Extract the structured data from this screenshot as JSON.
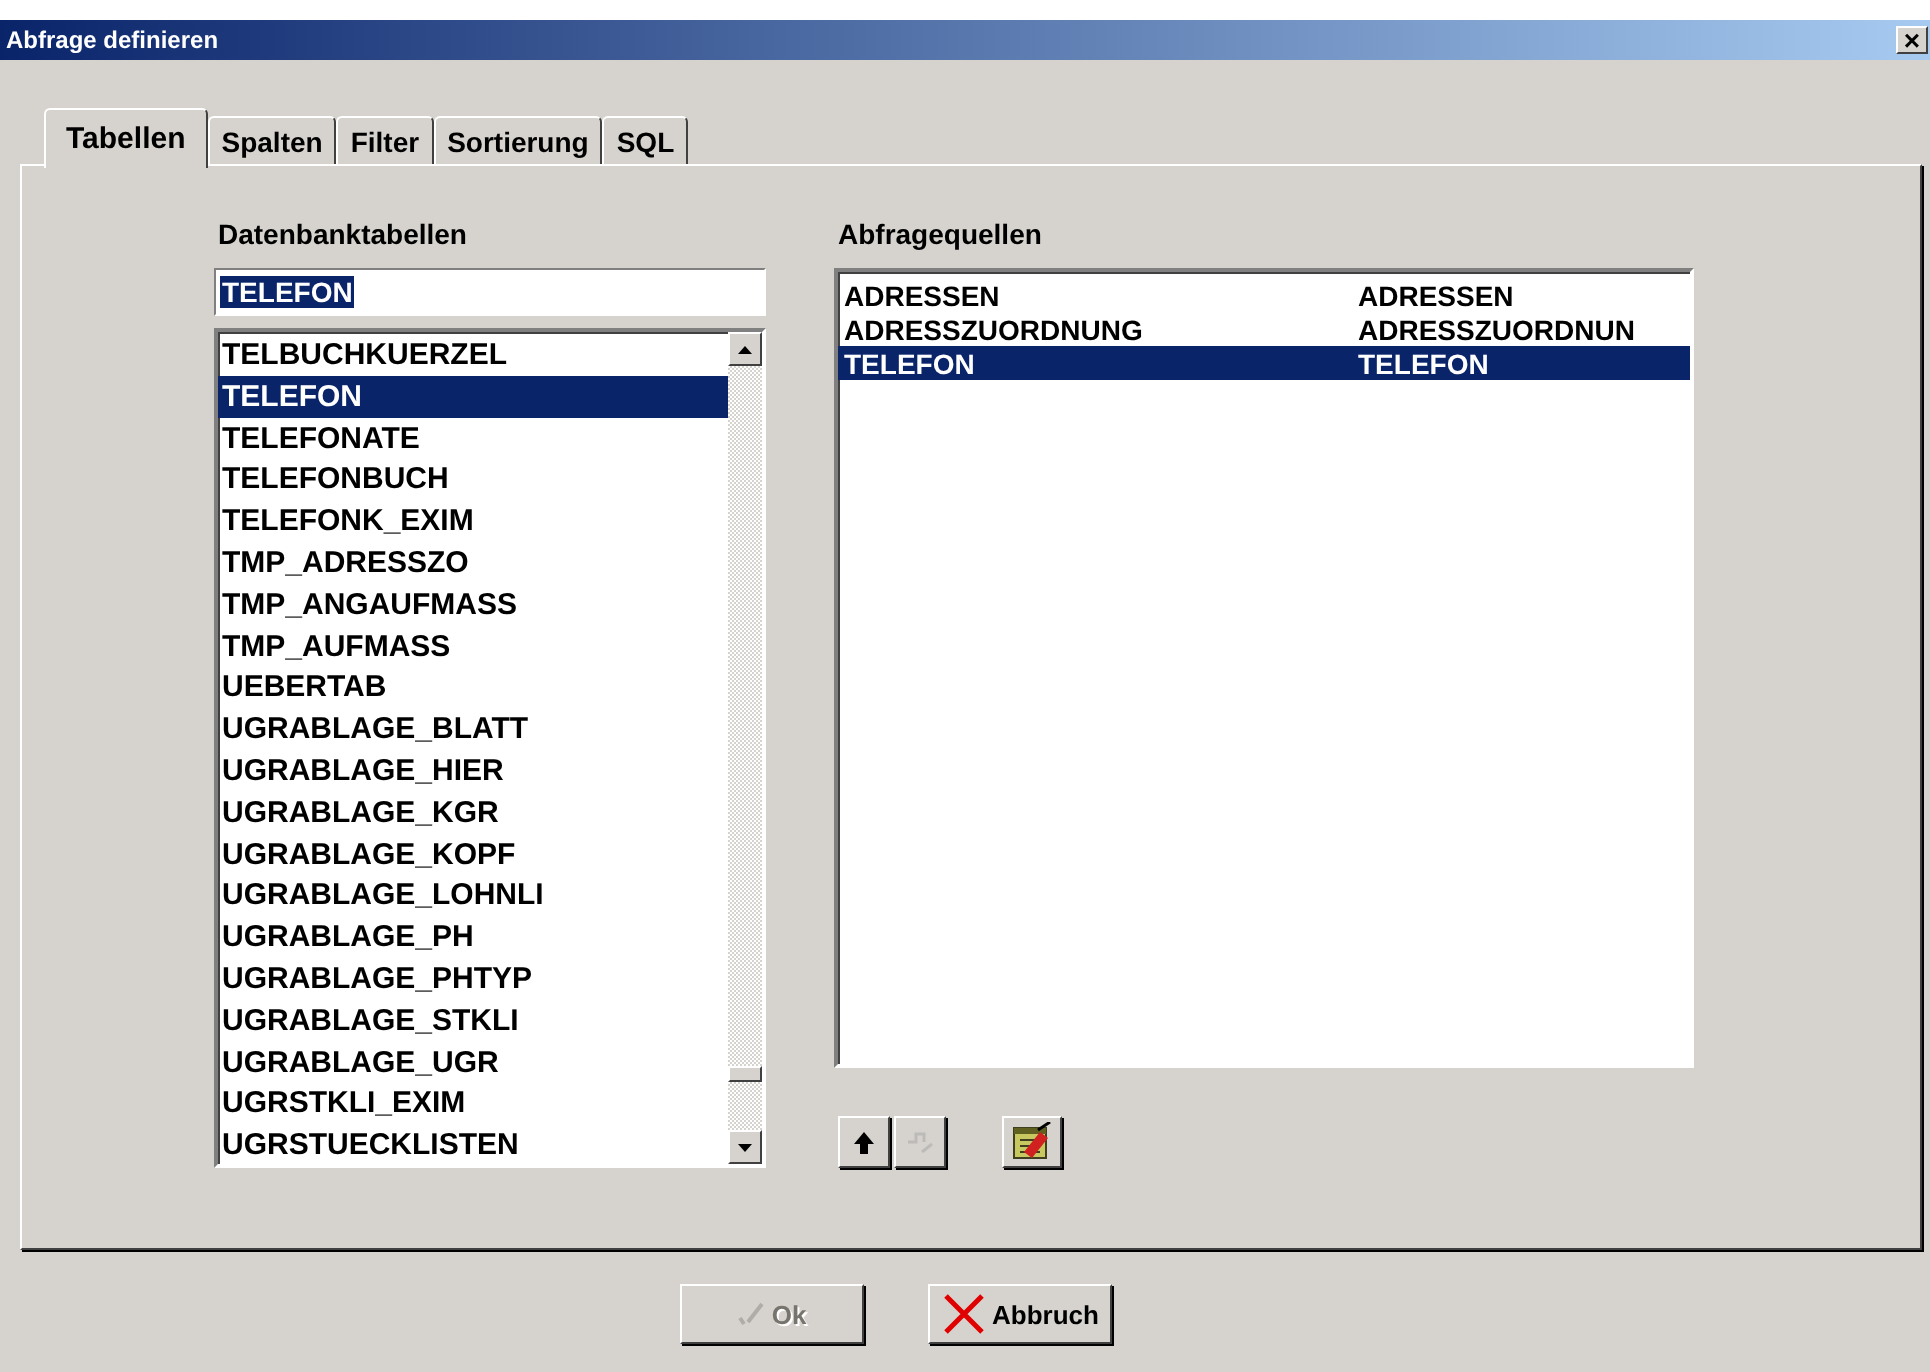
{
  "window": {
    "title": "Abfrage definieren",
    "close": "×"
  },
  "tabs": [
    {
      "label": "Tabellen",
      "selected": true
    },
    {
      "label": "Spalten",
      "selected": false
    },
    {
      "label": "Filter",
      "selected": false
    },
    {
      "label": "Sortierung",
      "selected": false
    },
    {
      "label": "SQL",
      "selected": false
    }
  ],
  "database_tables": {
    "label": "Datenbanktabellen",
    "search": {
      "value": "TELEFON"
    },
    "items": [
      {
        "label": "TELBUCHKUERZEL",
        "selected": false
      },
      {
        "label": "TELEFON",
        "selected": true
      },
      {
        "label": "TELEFONATE",
        "selected": false
      },
      {
        "label": "TELEFONBUCH",
        "selected": false
      },
      {
        "label": "TELEFONK_EXIM",
        "selected": false
      },
      {
        "label": "TMP_ADRESSZO",
        "selected": false
      },
      {
        "label": "TMP_ANGAUFMASS",
        "selected": false
      },
      {
        "label": "TMP_AUFMASS",
        "selected": false
      },
      {
        "label": "UEBERTAB",
        "selected": false
      },
      {
        "label": "UGRABLAGE_BLATT",
        "selected": false
      },
      {
        "label": "UGRABLAGE_HIER",
        "selected": false
      },
      {
        "label": "UGRABLAGE_KGR",
        "selected": false
      },
      {
        "label": "UGRABLAGE_KOPF",
        "selected": false
      },
      {
        "label": "UGRABLAGE_LOHNLI",
        "selected": false
      },
      {
        "label": "UGRABLAGE_PH",
        "selected": false
      },
      {
        "label": "UGRABLAGE_PHTYP",
        "selected": false
      },
      {
        "label": "UGRABLAGE_STKLI",
        "selected": false
      },
      {
        "label": "UGRABLAGE_UGR",
        "selected": false
      },
      {
        "label": "UGRSTKLI_EXIM",
        "selected": false
      },
      {
        "label": "UGRSTUECKLISTEN",
        "selected": false
      }
    ]
  },
  "query_sources": {
    "label": "Abfragequellen",
    "rows": [
      {
        "table": "ADRESSEN",
        "alias": "ADRESSEN",
        "selected": false
      },
      {
        "table": "ADRESSZUORDNUNG",
        "alias": "ADRESSZUORDNUN",
        "selected": false
      },
      {
        "table": "TELEFON",
        "alias": "TELEFON",
        "selected": true
      }
    ],
    "tools": [
      {
        "kind": "up",
        "disabled": false
      },
      {
        "kind": "step",
        "disabled": true
      },
      {
        "kind": "edit",
        "disabled": false
      }
    ]
  },
  "buttons": [
    {
      "label": "Ok",
      "kind": "ok",
      "disabled": true
    },
    {
      "label": "Abbruch",
      "kind": "cancel",
      "disabled": false
    }
  ]
}
